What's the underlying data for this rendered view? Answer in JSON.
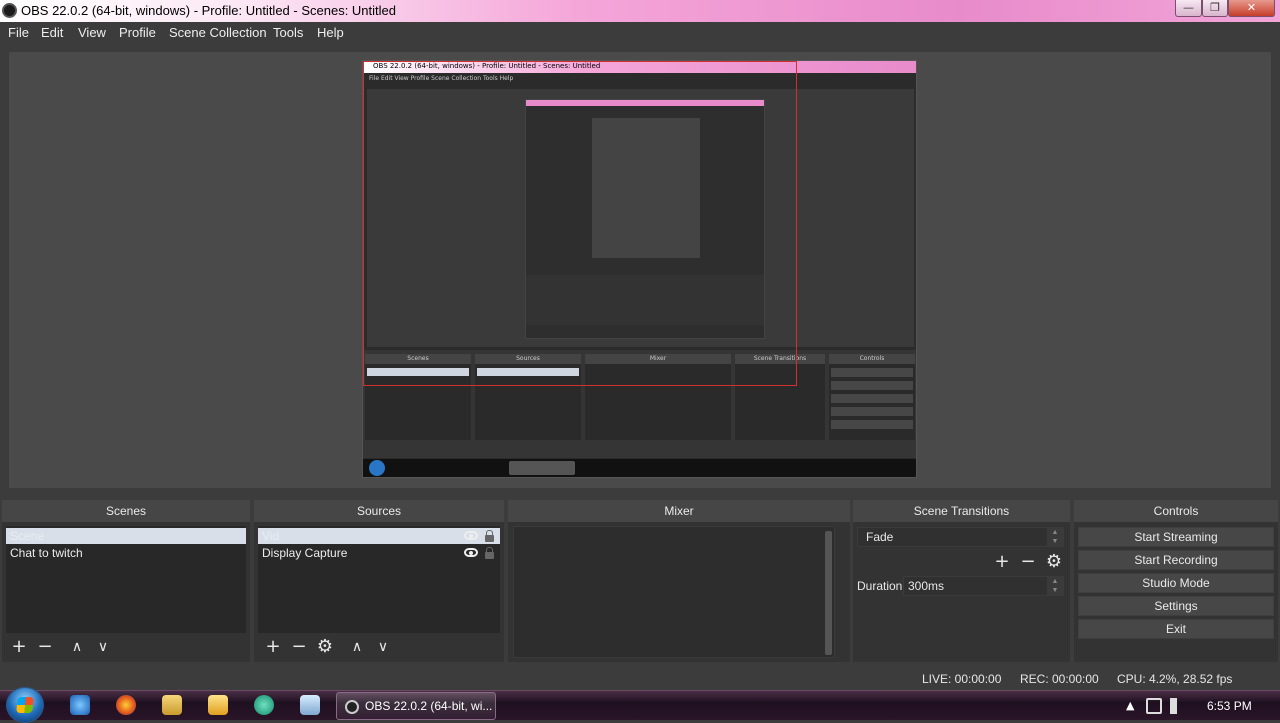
{
  "window": {
    "title": "OBS 22.0.2 (64-bit, windows) - Profile: Untitled - Scenes: Untitled"
  },
  "menu": [
    "File",
    "Edit",
    "View",
    "Profile",
    "Scene Collection",
    "Tools",
    "Help"
  ],
  "window_buttons": {
    "minimize": "—",
    "maximize": "❐",
    "close": "✕"
  },
  "preview": {
    "nested_title": "OBS 22.0.2 (64-bit, windows) - Profile: Untitled - Scenes: Untitled",
    "nested_menu": "File  Edit  View  Profile  Scene Collection  Tools  Help"
  },
  "scenes": {
    "header": "Scenes",
    "items": [
      "Scene",
      "Chat to twitch"
    ],
    "selected_index": 0
  },
  "sources": {
    "header": "Sources",
    "items": [
      "Vid",
      "Display Capture"
    ],
    "selected_index": 0
  },
  "mixer": {
    "header": "Mixer"
  },
  "transitions": {
    "header": "Scene Transitions",
    "selected": "Fade",
    "duration_label": "Duration",
    "duration_value": "300ms"
  },
  "controls": {
    "header": "Controls",
    "buttons": [
      "Start Streaming",
      "Start Recording",
      "Studio Mode",
      "Settings",
      "Exit"
    ]
  },
  "status": {
    "live": "LIVE: 00:00:00",
    "rec": "REC: 00:00:00",
    "cpu": "CPU: 4.2%, 28.52 fps"
  },
  "taskbar": {
    "active_task": "OBS 22.0.2 (64-bit, wi...",
    "clock": "6:53 PM",
    "tray_arrow": "▲"
  },
  "toolbar_glyphs": {
    "add": "+",
    "remove": "−",
    "up": "∧",
    "down": "∨",
    "settings": "⚙"
  },
  "colors": {
    "accent_pink": "#f5a6d9",
    "panel_bg": "#333333",
    "selected_item": "#d8dfe8",
    "preview_outline": "#d03030"
  }
}
